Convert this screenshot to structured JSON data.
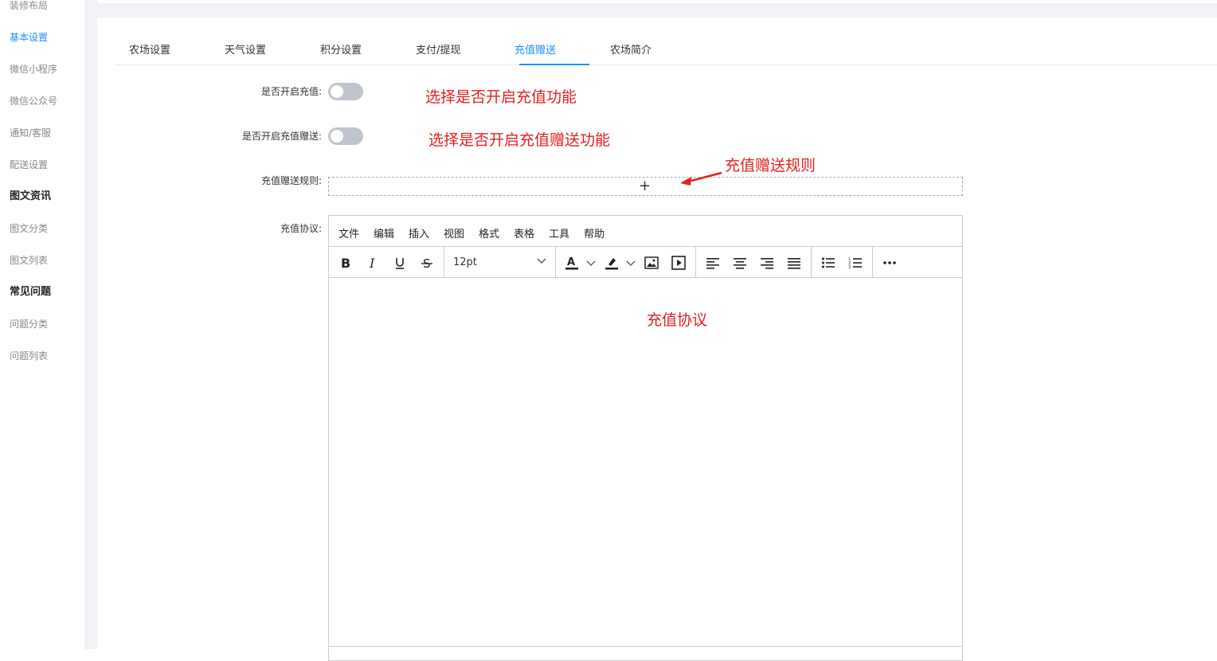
{
  "sidebar": {
    "items": [
      {
        "label": "装修布局",
        "type": "item"
      },
      {
        "label": "基本设置",
        "type": "active"
      },
      {
        "label": "微信小程序",
        "type": "item"
      },
      {
        "label": "微信公众号",
        "type": "item"
      },
      {
        "label": "通知/客服",
        "type": "item"
      },
      {
        "label": "配送设置",
        "type": "item"
      },
      {
        "label": "图文资讯",
        "type": "group"
      },
      {
        "label": "图文分类",
        "type": "item"
      },
      {
        "label": "图文列表",
        "type": "item"
      },
      {
        "label": "常见问题",
        "type": "group"
      },
      {
        "label": "问题分类",
        "type": "item"
      },
      {
        "label": "问题列表",
        "type": "item"
      }
    ]
  },
  "tabs": [
    {
      "label": "农场设置"
    },
    {
      "label": "天气设置"
    },
    {
      "label": "积分设置"
    },
    {
      "label": "支付/提现"
    },
    {
      "label": "充值赠送",
      "active": true
    },
    {
      "label": "农场简介"
    }
  ],
  "form": {
    "recharge_label": "是否开启充值:",
    "recharge_on": false,
    "bonus_label": "是否开启充值赠送:",
    "bonus_on": false,
    "rules_label": "充值赠送规则:",
    "rules_add": "+",
    "agreement_label": "充值协议:"
  },
  "annotations": {
    "a1": "选择是否开启充值功能",
    "a2": "选择是否开启充值赠送功能",
    "a3": "充值赠送规则",
    "a4": "充值协议",
    "color": "#e02020"
  },
  "editor": {
    "menu": [
      "文件",
      "编辑",
      "插入",
      "视图",
      "格式",
      "表格",
      "工具",
      "帮助"
    ],
    "font_size": "12pt",
    "toolbar_icons": [
      "bold-icon",
      "italic-icon",
      "underline-icon",
      "strikethrough-icon",
      "text-color-icon",
      "highlight-icon",
      "image-icon",
      "media-icon",
      "align-left-icon",
      "align-center-icon",
      "align-right-icon",
      "align-justify-icon",
      "bullet-list-icon",
      "numbered-list-icon",
      "more-icon"
    ]
  },
  "colors": {
    "accent": "#1890ff",
    "frame": "#f0f2f5"
  }
}
